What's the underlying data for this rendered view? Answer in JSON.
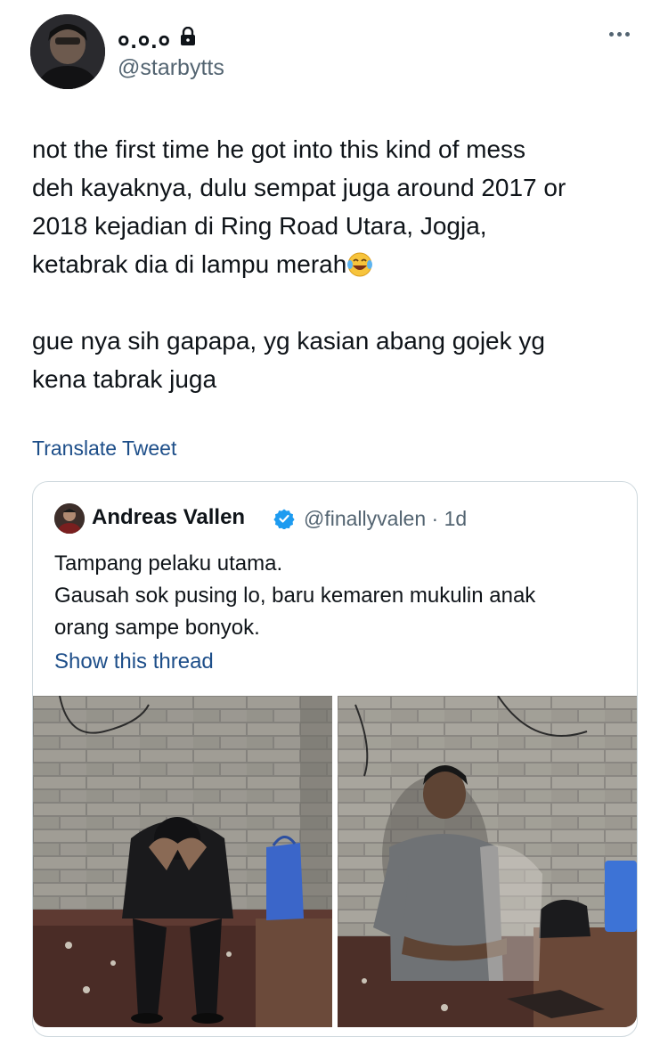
{
  "tweet": {
    "author": {
      "display_name": "०.०.०",
      "handle": "@starbytts",
      "protected_icon": "lock-icon"
    },
    "more_icon": "more-horizontal-icon",
    "paragraphs": [
      "not the first time he got into this kind of mess\ndeh kayaknya, dulu sempat juga around 2017 or\n2018 kejadian di Ring Road Utara, Jogja,\nketabrak dia di lampu merah",
      "gue nya sih gapapa, yg kasian abang gojek yg\nkena tabrak juga"
    ],
    "emoji": "face-with-tears-of-joy",
    "translate_label": "Translate Tweet"
  },
  "quoted_tweet": {
    "display_name": "Andreas Vallen",
    "verified_icon": "verified-badge-icon",
    "meta": "@finallyvalen · 1d",
    "text": "Tampang pelaku utama.\nGausah sok pusing lo, baru kemaren mukulin anak\norang sampe bonyok.",
    "show_thread_label": "Show this thread",
    "media": [
      "photo-man-head-in-hands",
      "photo-man-seated"
    ]
  },
  "colors": {
    "text": "#0f1419",
    "secondary": "#536471",
    "link": "#1d4e89",
    "verified": "#1d9bf0",
    "border": "#cfd9de"
  }
}
